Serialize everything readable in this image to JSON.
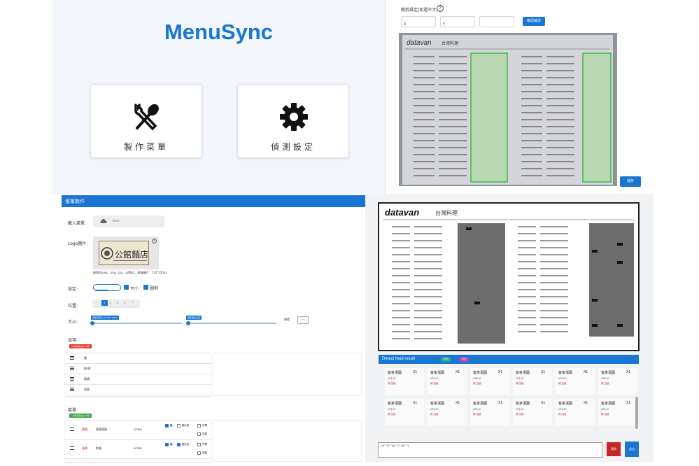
{
  "home": {
    "app_title": "MenuSync",
    "tiles": [
      {
        "label": "製作菜單",
        "icon": "utensils-icon"
      },
      {
        "label": "偵測設定",
        "icon": "gear-icon"
      }
    ]
  },
  "detect_settings": {
    "header": "裁剪設定(如過不大)",
    "fields": [
      {
        "label": "",
        "value": "X"
      },
      {
        "label": "",
        "value": "Y"
      },
      {
        "label": "",
        "value": ""
      }
    ],
    "apply_button": "確認裁剪",
    "save_button": "儲存"
  },
  "menu_editor": {
    "title": "菜單製作",
    "import_label": "載入菜單:",
    "import_placeholder": "Json",
    "logo_label": "Logo圖片:",
    "logo_text": "公館麵店",
    "logo_hint": "僅限於jpeg、png、jpg、gif格式，建議圖片：110*220px",
    "settings_label": "設定:",
    "settings_toggle": [
      "直式",
      "橫式"
    ],
    "settings_checks": [
      "大小",
      "圖例"
    ],
    "position_label": "位置:",
    "position_options": [
      "1",
      "2",
      "3",
      "4"
    ],
    "size_label": "大小:",
    "slider_bubbles": [
      "調整字型大小(FONT SIZE)",
      "調整欄位寬度"
    ],
    "preview_button": "預覽",
    "category_label": "品項:",
    "category_tag": "+新增項目(至少1項)",
    "categories": [
      "麵",
      "飯/粥",
      "麵類",
      "加量"
    ],
    "dishes_label": "菜單:",
    "dishes_tag": "+新增項目(至少1項)",
    "dishes": [
      {
        "category": "麵類",
        "name": "意麵湯麵",
        "price": "NT$40",
        "options": [
          "麵",
          "超大份",
          "外帶",
          "加量"
        ]
      },
      {
        "category": "麵類",
        "name": "乾麵",
        "price": "NT$35",
        "options": [
          "麵",
          "超大份",
          "外帶",
          "加量"
        ]
      },
      {
        "category": "",
        "name": "",
        "price": "",
        "options": []
      }
    ]
  },
  "detect_result": {
    "doc_brand": "datavan",
    "doc_title": "台灣料理",
    "title": "Detect food result",
    "tags": [
      "+新增",
      "+清空"
    ],
    "cards": [
      {
        "name": "客家湯圓",
        "qty": "X1",
        "price": "NT$ 40",
        "option": "辣 加量"
      },
      {
        "name": "客家湯圓",
        "qty": "X1",
        "price": "NT$ 40",
        "option": "辣 加量"
      },
      {
        "name": "客家湯圓",
        "qty": "X1",
        "price": "NT$ 40",
        "option": "辣 加量"
      },
      {
        "name": "客家湯圓",
        "qty": "X1",
        "price": "NT$ 40",
        "option": "辣 加量"
      },
      {
        "name": "客家湯圓",
        "qty": "X1",
        "price": "NT$ 40",
        "option": "辣 加量"
      },
      {
        "name": "客家湯圓",
        "qty": "X1",
        "price": "NT$ 40",
        "option": "辣 加量"
      },
      {
        "name": "客家湯圓",
        "qty": "X1",
        "price": "NT$ 40",
        "option": "辣 加量"
      },
      {
        "name": "客家湯圓",
        "qty": "X1",
        "price": "NT$ 40",
        "option": "辣 加量"
      },
      {
        "name": "客家湯圓",
        "qty": "X1",
        "price": "NT$ 40",
        "option": "辣 加量"
      },
      {
        "name": "客家湯圓",
        "qty": "X1",
        "price": "NT$ 40",
        "option": "辣 加量"
      },
      {
        "name": "客家湯圓",
        "qty": "X1",
        "price": "NT$ 40",
        "option": "辣 加量"
      },
      {
        "name": "客家湯圓",
        "qty": "X1",
        "price": "NT$ 40",
        "option": "辣 加量"
      }
    ],
    "output_text": "{\"id\":\"13\",\"qty\":\"1\",\"opt\":\"\"}",
    "clear_button": "清除",
    "send_button": "送出"
  }
}
